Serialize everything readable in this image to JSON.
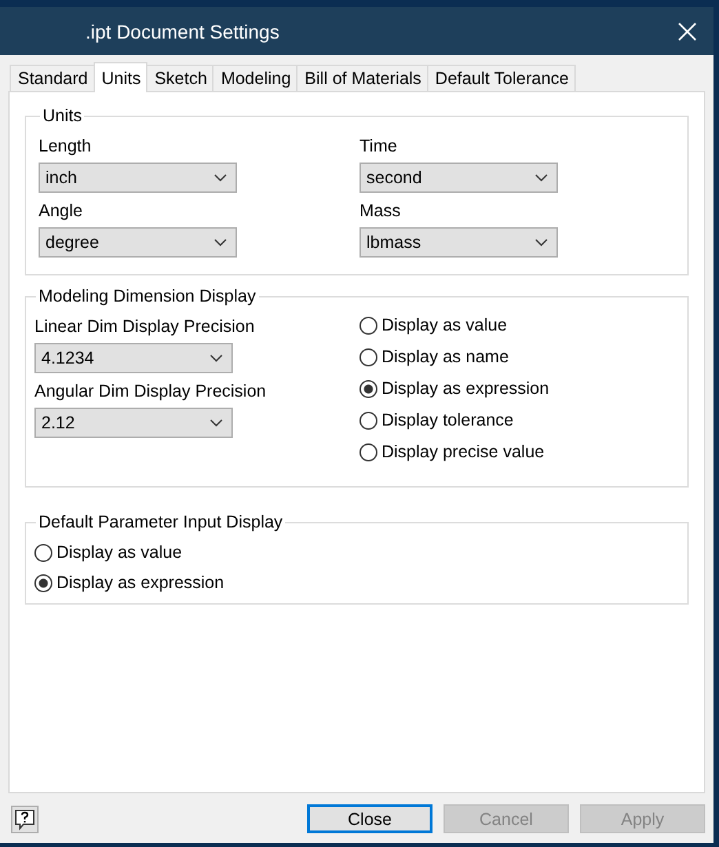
{
  "window": {
    "title": ".ipt Document Settings"
  },
  "tabs": [
    {
      "label": "Standard",
      "selected": false
    },
    {
      "label": "Units",
      "selected": true
    },
    {
      "label": "Sketch",
      "selected": false
    },
    {
      "label": "Modeling",
      "selected": false
    },
    {
      "label": "Bill of Materials",
      "selected": false
    },
    {
      "label": "Default Tolerance",
      "selected": false
    }
  ],
  "units": {
    "title": "Units",
    "fields": [
      {
        "label": "Length",
        "value": "inch"
      },
      {
        "label": "Time",
        "value": "second"
      },
      {
        "label": "Angle",
        "value": "degree"
      },
      {
        "label": "Mass",
        "value": "lbmass"
      }
    ]
  },
  "modeling_dimension_display": {
    "title": "Modeling Dimension Display",
    "fields": [
      {
        "label": "Linear Dim Display Precision",
        "value": "4.1234"
      },
      {
        "label": "Angular Dim Display Precision",
        "value": "2.12"
      }
    ],
    "options": [
      {
        "label": "Display as value",
        "selected": false
      },
      {
        "label": "Display as name",
        "selected": false
      },
      {
        "label": "Display as expression",
        "selected": true
      },
      {
        "label": "Display tolerance",
        "selected": false
      },
      {
        "label": "Display precise value",
        "selected": false
      }
    ]
  },
  "default_parameter_input_display": {
    "title": "Default Parameter Input Display",
    "options": [
      {
        "label": "Display as value",
        "selected": false
      },
      {
        "label": "Display as expression",
        "selected": true
      }
    ]
  },
  "buttons": [
    {
      "label": "Close",
      "focused": true,
      "disabled": false
    },
    {
      "label": "Cancel",
      "focused": false,
      "disabled": true
    },
    {
      "label": "Apply",
      "focused": false,
      "disabled": true
    }
  ]
}
